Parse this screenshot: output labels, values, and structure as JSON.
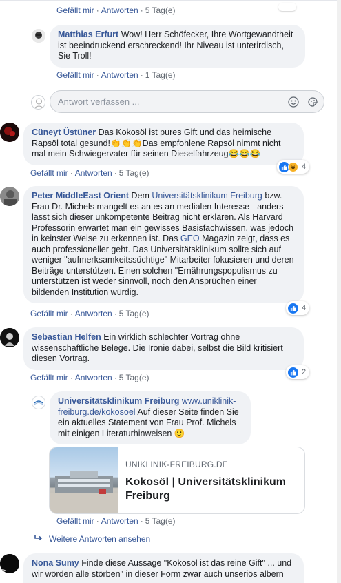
{
  "colors": {
    "link": "#385898",
    "bubble": "#f0f2f5",
    "like": "#1877f2",
    "haha": "#f7b125"
  },
  "top_actions": {
    "like": "Gefällt mir",
    "reply": "Antworten",
    "time": "5 Tag(e)"
  },
  "comments": [
    {
      "author": "Matthias Erfurt",
      "text": "Wow! Herr Schöfecker, Ihre Wortgewandtheit ist beeindruckend erschreckend! Ihr Niveau ist unterirdisch, Sie Troll!",
      "like": "Gefällt mir",
      "reply": "Antworten",
      "time": "1 Tag(e)"
    },
    {
      "author": "Cüneyt Üstüner",
      "text": "Das Kokosöl ist pures Gift und das heimische Rapsöl total gesund!",
      "text2": "Das empfohlene Rapsöl nimmt nicht mal mein Schwiegervater für seinen Dieselfahrzeug",
      "like": "Gefällt mir",
      "reply": "Antworten",
      "time": "5 Tag(e)",
      "reactions": {
        "icons": [
          "like",
          "haha"
        ],
        "count": "4"
      }
    },
    {
      "author": "Peter MiddleEast Orient",
      "text_a": "Dem",
      "mention1": "Universitätsklinikum Freiburg",
      "text_b": "bzw. Frau Dr. Michels mangelt es an es an medialen Interesse - anders lässt sich dieser unkompetente Beitrag nicht erklären. Als Harvard Professorin erwartet man ein gewisses Basisfachwissen, was jedoch in keinster Weise zu erkennen ist. Das",
      "mention2": "GEO",
      "text_c": "Magazin zeigt, dass es auch professioneller geht. Das Universitätsklinikum sollte sich auf weniger \"aufmerksamkeitssüchtige\" Mitarbeiter fokusieren und deren Beiträge unterstützen. Einen solchen \"Ernährungspopulismus zu unterstützen ist weder sinnvoll, noch den Ansprüchen einer bildenden Institution würdig.",
      "like": "Gefällt mir",
      "reply": "Antworten",
      "time": "5 Tag(e)",
      "reactions": {
        "icons": [
          "like"
        ],
        "count": "4"
      }
    },
    {
      "author": "Sebastian Helfen",
      "text": "Ein wirklich schlechter Vortrag ohne wissenschaftliche Belege. Die Ironie dabei, selbst die Bild kritisiert diesen Vortrag.",
      "like": "Gefällt mir",
      "reply": "Antworten",
      "time": "5 Tag(e)",
      "reactions": {
        "icons": [
          "like"
        ],
        "count": "2"
      }
    },
    {
      "author": "Universitätsklinikum Freiburg",
      "url": "www.uniklinik-freiburg.de/kokosoel",
      "text": "Auf dieser Seite finden Sie ein aktuelles Statement von Frau Prof. Michels mit einigen Literaturhinweisen",
      "like": "Gefällt mir",
      "reply": "Antworten",
      "time": "5 Tag(e)",
      "link_card": {
        "domain": "UNIKLINIK-FREIBURG.DE",
        "title": "Kokosöl | Universitätsklinikum Freiburg"
      }
    },
    {
      "author": "Nona Sumy",
      "text": "Finde diese Aussage \"Kokosöl ist das reine Gift\" ... und wir wörden alle störben\" in dieser Form zwar auch unseriös albern"
    }
  ],
  "reply_box": {
    "placeholder": "Antwort verfassen ..."
  },
  "more_replies": "Weitere Antworten ansehen",
  "icons": [
    "smiley-icon",
    "sticker-icon",
    "clap-emoji-icon",
    "laughing-emoji-icon",
    "slightly-smiling-emoji-icon",
    "reply-arrow-icon",
    "like-reaction-icon",
    "haha-reaction-icon"
  ]
}
